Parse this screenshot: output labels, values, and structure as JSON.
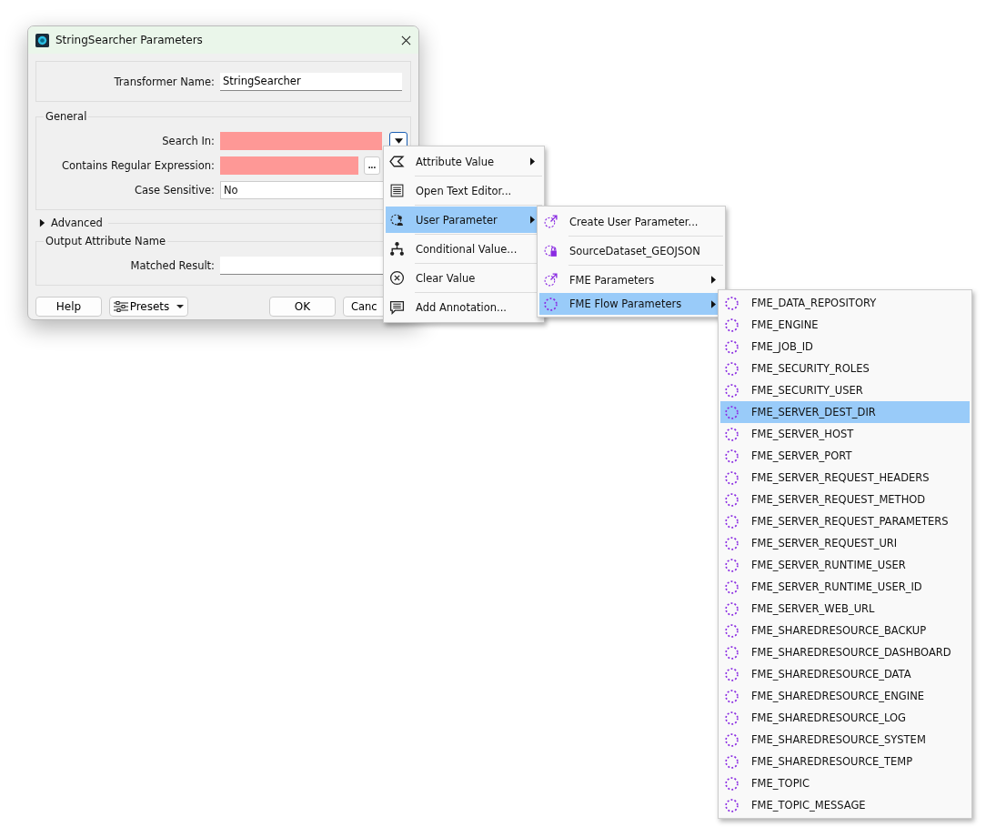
{
  "window": {
    "title": "StringSearcher Parameters"
  },
  "transformer_name": {
    "label": "Transformer Name:",
    "value": "StringSearcher"
  },
  "general": {
    "title": "General",
    "fields": [
      {
        "kind": "attribute",
        "label": "Search In:",
        "invalid": true
      },
      {
        "kind": "text",
        "label": "Contains Regular Expression:",
        "invalid": true,
        "button": "..."
      },
      {
        "kind": "select",
        "label": "Case Sensitive:",
        "value": "No"
      }
    ]
  },
  "advanced": {
    "label": "Advanced",
    "expanded": false
  },
  "output": {
    "title": "Output Attribute Name",
    "label": "Matched Result:"
  },
  "buttons": [
    {
      "kind": "plain",
      "label": "Help"
    },
    {
      "kind": "menu",
      "label": "Presets"
    },
    {
      "kind": "plain",
      "label": "OK"
    },
    {
      "kind": "plain",
      "label": "Canc"
    }
  ],
  "menu": [
    {
      "kind": "attribute",
      "label": "Attribute Value",
      "submenu": true,
      "selected": false
    },
    {
      "kind": "editor",
      "label": "Open Text Editor...",
      "submenu": false,
      "selected": false
    },
    {
      "kind": "user",
      "label": "User Parameter",
      "submenu": true,
      "selected": true
    },
    {
      "kind": "conditional",
      "label": "Conditional Value...",
      "submenu": false,
      "selected": false
    },
    {
      "kind": "clear",
      "label": "Clear Value",
      "submenu": false,
      "selected": false
    },
    {
      "kind": "annotation",
      "label": "Add Annotation...",
      "submenu": false,
      "selected": false
    }
  ],
  "user_parameter_menu": [
    {
      "kind": "create",
      "label": "Create User Parameter...",
      "submenu": false,
      "selected": false
    },
    {
      "kind": "locked",
      "label": "SourceDataset_GEOJSON",
      "submenu": false,
      "selected": false
    },
    {
      "kind": "create",
      "label": "FME Parameters",
      "submenu": true,
      "selected": false
    },
    {
      "kind": "flow",
      "label": "FME Flow Parameters",
      "submenu": true,
      "selected": true
    }
  ],
  "flow_parameters_menu": [
    {
      "label": "FME_DATA_REPOSITORY",
      "selected": false
    },
    {
      "label": "FME_ENGINE",
      "selected": false
    },
    {
      "label": "FME_JOB_ID",
      "selected": false
    },
    {
      "label": "FME_SECURITY_ROLES",
      "selected": false
    },
    {
      "label": "FME_SECURITY_USER",
      "selected": false
    },
    {
      "label": "FME_SERVER_DEST_DIR",
      "selected": true
    },
    {
      "label": "FME_SERVER_HOST",
      "selected": false
    },
    {
      "label": "FME_SERVER_PORT",
      "selected": false
    },
    {
      "label": "FME_SERVER_REQUEST_HEADERS",
      "selected": false
    },
    {
      "label": "FME_SERVER_REQUEST_METHOD",
      "selected": false
    },
    {
      "label": "FME_SERVER_REQUEST_PARAMETERS",
      "selected": false
    },
    {
      "label": "FME_SERVER_REQUEST_URI",
      "selected": false
    },
    {
      "label": "FME_SERVER_RUNTIME_USER",
      "selected": false
    },
    {
      "label": "FME_SERVER_RUNTIME_USER_ID",
      "selected": false
    },
    {
      "label": "FME_SERVER_WEB_URL",
      "selected": false
    },
    {
      "label": "FME_SHAREDRESOURCE_BACKUP",
      "selected": false
    },
    {
      "label": "FME_SHAREDRESOURCE_DASHBOARD",
      "selected": false
    },
    {
      "label": "FME_SHAREDRESOURCE_DATA",
      "selected": false
    },
    {
      "label": "FME_SHAREDRESOURCE_ENGINE",
      "selected": false
    },
    {
      "label": "FME_SHAREDRESOURCE_LOG",
      "selected": false
    },
    {
      "label": "FME_SHAREDRESOURCE_SYSTEM",
      "selected": false
    },
    {
      "label": "FME_SHAREDRESOURCE_TEMP",
      "selected": false
    },
    {
      "label": "FME_TOPIC",
      "selected": false
    },
    {
      "label": "FME_TOPIC_MESSAGE",
      "selected": false
    }
  ]
}
